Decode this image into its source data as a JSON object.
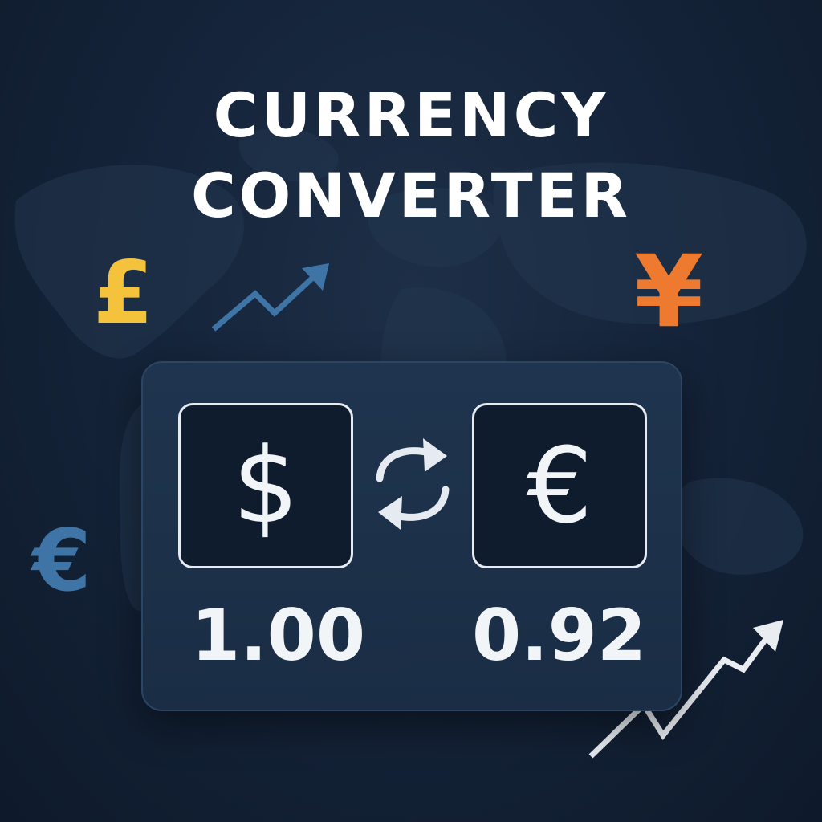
{
  "header": {
    "title_line_1": "CURRENCY",
    "title_line_2": "CONVERTER"
  },
  "decorations": {
    "pound_symbol": "£",
    "yen_symbol": "¥",
    "euro_symbol": "€",
    "icons": [
      "trend-up-arrow-icon",
      "world-map"
    ]
  },
  "converter": {
    "from_currency_symbol": "$",
    "to_currency_symbol": "€",
    "from_amount": "1.00",
    "to_amount": "0.92",
    "swap_icon": "swap-arrows-icon"
  },
  "colors": {
    "background": "#15243a",
    "pound": "#f5c33b",
    "yen": "#ee7a2f",
    "euro_float": "#3f74a6",
    "trend_small": "#3f74a6",
    "trend_large": "#e9edf2",
    "text": "#ffffff"
  }
}
